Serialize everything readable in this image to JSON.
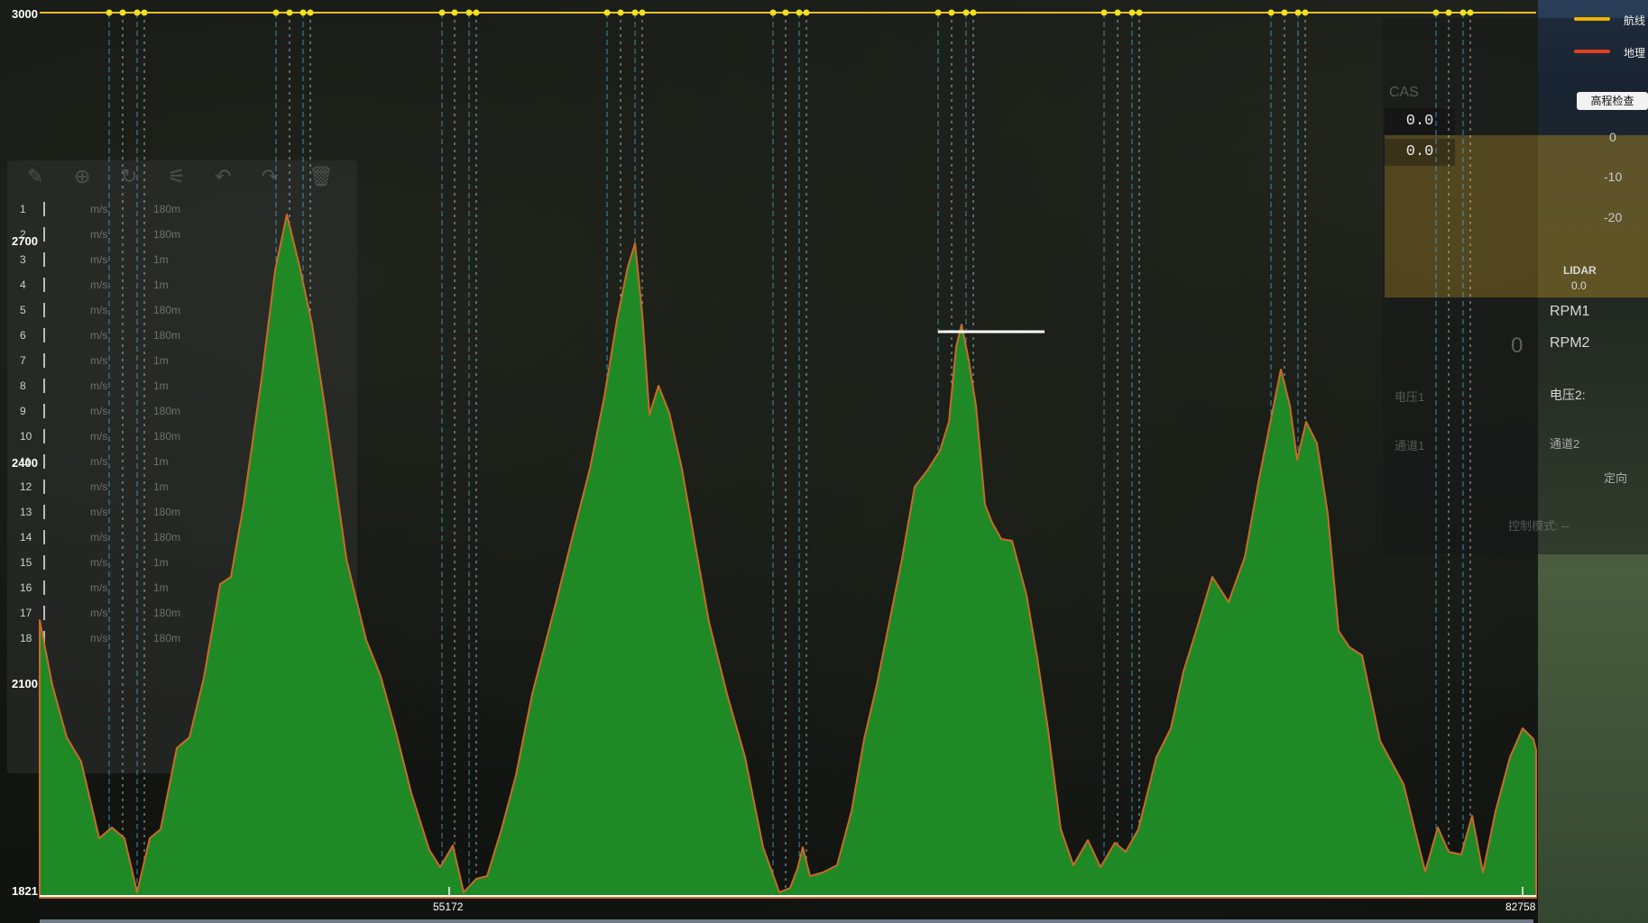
{
  "profile": {
    "y_labels": [
      "3000",
      "2700",
      "2400",
      "2100",
      "1821"
    ],
    "x_labels": [
      "55172",
      "82758"
    ],
    "y_range": [
      1821,
      3000
    ],
    "x_range": [
      0,
      82758
    ],
    "terrain_color": "#1f8a25",
    "terrain_edge_color": "#c96a2a",
    "route_color": "#e8c020",
    "waypoint_dot_color": "#f0e020",
    "cursor_line_color": "#ffffff"
  },
  "mission_panel": {
    "rows": [
      {
        "num": "1",
        "speed": "m/s",
        "alt": "180m"
      },
      {
        "num": "2",
        "speed": "m/s",
        "alt": "180m"
      },
      {
        "num": "3",
        "speed": "m/s",
        "alt": "1m"
      },
      {
        "num": "4",
        "speed": "m/s",
        "alt": "1m"
      },
      {
        "num": "5",
        "speed": "m/s",
        "alt": "180m"
      },
      {
        "num": "6",
        "speed": "m/s",
        "alt": "180m"
      },
      {
        "num": "7",
        "speed": "m/s",
        "alt": "1m"
      },
      {
        "num": "8",
        "speed": "m/s",
        "alt": "1m"
      },
      {
        "num": "9",
        "speed": "m/s",
        "alt": "180m"
      },
      {
        "num": "10",
        "speed": "m/s",
        "alt": "180m"
      },
      {
        "num": "11",
        "speed": "m/s",
        "alt": "1m"
      },
      {
        "num": "12",
        "speed": "m/s",
        "alt": "1m"
      },
      {
        "num": "13",
        "speed": "m/s",
        "alt": "180m"
      },
      {
        "num": "14",
        "speed": "m/s",
        "alt": "180m"
      },
      {
        "num": "15",
        "speed": "m/s",
        "alt": "1m"
      },
      {
        "num": "16",
        "speed": "m/s",
        "alt": "1m"
      },
      {
        "num": "17",
        "speed": "m/s",
        "alt": "180m"
      },
      {
        "num": "18",
        "speed": "m/s",
        "alt": "180m"
      }
    ]
  },
  "hud": {
    "cas_label": "CAS",
    "airspeed_value": "0.0",
    "altitude_value": "0.0",
    "lidar_label": "LIDAR",
    "lidar_value": "0.0",
    "rpm1_label": "RPM1",
    "rpm2_label": "RPM2",
    "voltage2_label": "电压2:",
    "voltage1_label": "电压1",
    "channel2_label": "通道2",
    "channel1_label": "通道1",
    "heading_label": "定向",
    "control_mode_label": "控制模式: --",
    "rpm_value": "0",
    "ticks": [
      "0",
      "-10",
      "-20"
    ],
    "elevation_check_button": "高程检查",
    "legend_route": "航线",
    "legend_terrain": "地理",
    "legend_route_color": "#f0b400",
    "legend_terrain_color": "#e0401c"
  }
}
